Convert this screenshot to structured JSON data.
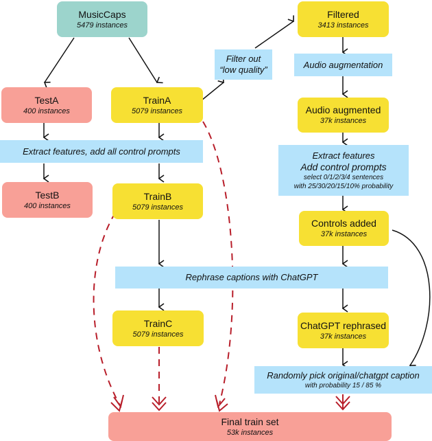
{
  "nodes": {
    "musiccaps": {
      "title": "MusicCaps",
      "sub": "5479 instances"
    },
    "testA": {
      "title": "TestA",
      "sub": "400 instances"
    },
    "trainA": {
      "title": "TrainA",
      "sub": "5079 instances"
    },
    "testB": {
      "title": "TestB",
      "sub": "400 instances"
    },
    "trainB": {
      "title": "TrainB",
      "sub": "5079 instances"
    },
    "trainC": {
      "title": "TrainC",
      "sub": "5079 instances"
    },
    "filtered": {
      "title": "Filtered",
      "sub": "3413 instances"
    },
    "audio_augmented": {
      "title": "Audio augmented",
      "sub": "37k instances"
    },
    "controls_added": {
      "title": "Controls added",
      "sub": "37k instances"
    },
    "chatgpt_rephrased": {
      "title": "ChatGPT rephrased",
      "sub": "37k instances"
    },
    "final": {
      "title": "Final train set",
      "sub": "53k instances"
    }
  },
  "steps": {
    "extract_all": "Extract features, add all control prompts",
    "filter_line1": "Filter out",
    "filter_line2": "“low quality”",
    "audio_aug": "Audio augmentation",
    "extract2_line1": "Extract features",
    "extract2_line2": "Add control prompts",
    "extract2_line3": "select 0/1/2/3/4 sentences",
    "extract2_line4": "with 25/30/20/15/10% probability",
    "rephrase": "Rephrase captions with ChatGPT",
    "random_pick": "Randomly pick original/chatgpt caption",
    "random_prob": "with probability 15 / 85 %"
  },
  "colors": {
    "dataset_source": "#9cd4cc",
    "test_set": "#f8a097",
    "train_set": "#f7e033",
    "process_step": "#b5e3fb",
    "merge_arrow": "#b81e2a"
  }
}
